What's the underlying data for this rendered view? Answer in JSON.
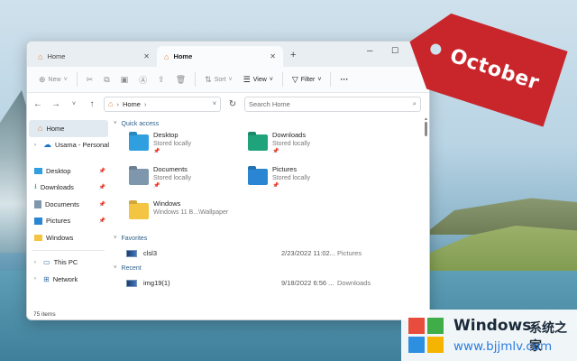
{
  "tabs": [
    {
      "label": "Home"
    },
    {
      "label": "Home"
    }
  ],
  "toolbar": {
    "new": "New",
    "sort": "Sort",
    "view": "View",
    "filter": "Filter",
    "more": "···"
  },
  "address": {
    "path": "Home",
    "search_placeholder": "Search Home"
  },
  "sidebar": {
    "items": [
      {
        "label": "Home"
      },
      {
        "label": "Usama - Personal"
      },
      {
        "label": "Desktop"
      },
      {
        "label": "Downloads"
      },
      {
        "label": "Documents"
      },
      {
        "label": "Pictures"
      },
      {
        "label": "Windows"
      },
      {
        "label": "This PC"
      },
      {
        "label": "Network"
      }
    ]
  },
  "quick_access": {
    "title": "Quick access",
    "items": [
      {
        "name": "Desktop",
        "sub": "Stored locally",
        "color": "#2f9fe0"
      },
      {
        "name": "Downloads",
        "sub": "Stored locally",
        "color": "#1fa37a"
      },
      {
        "name": "Documents",
        "sub": "Stored locally",
        "color": "#7f97ad"
      },
      {
        "name": "Pictures",
        "sub": "Stored locally",
        "color": "#2a86d2"
      },
      {
        "name": "Windows",
        "sub": "Windows 11 B...\\Wallpaper",
        "color": "#f4c542"
      }
    ]
  },
  "favorites": {
    "title": "Favorites",
    "rows": [
      {
        "name": "clsl3",
        "date": "2/23/2022 11:02...",
        "location": "Pictures"
      }
    ]
  },
  "recent": {
    "title": "Recent",
    "rows": [
      {
        "name": "img19(1)",
        "date": "9/18/2022 6:56 ...",
        "location": "Downloads"
      }
    ]
  },
  "status": "75 items",
  "tag": {
    "text": "October"
  },
  "logo": {
    "title": "Windows",
    "title_cn": "系统之家",
    "url": "www.bjjmlv.com"
  }
}
